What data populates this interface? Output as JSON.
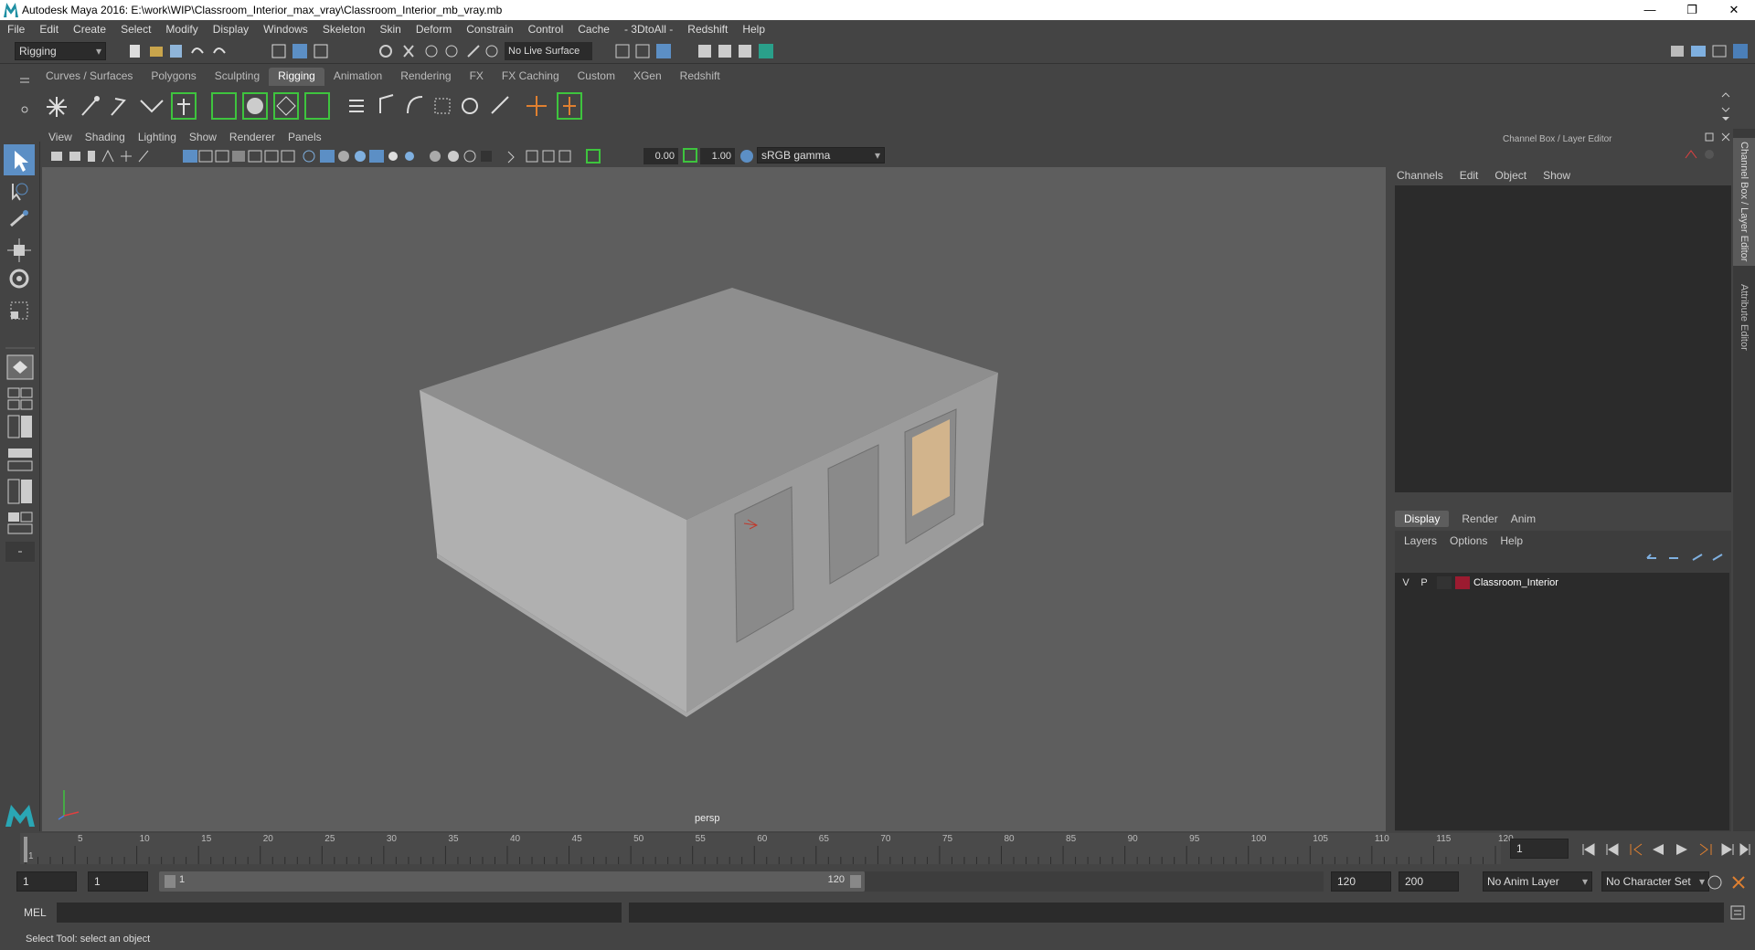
{
  "window": {
    "title": "Autodesk Maya 2016: E:\\work\\WIP\\Classroom_Interior_max_vray\\Classroom_Interior_mb_vray.mb",
    "controls": [
      "—",
      "❐",
      "✕"
    ]
  },
  "menubar": [
    "File",
    "Edit",
    "Create",
    "Select",
    "Modify",
    "Display",
    "Windows",
    "Skeleton",
    "Skin",
    "Deform",
    "Constrain",
    "Control",
    "Cache",
    "- 3DtoAll -",
    "Redshift",
    "Help"
  ],
  "statusline": {
    "menuset": "Rigging",
    "live_surface": "No Live Surface"
  },
  "shelf": {
    "tabs": [
      "Curves / Surfaces",
      "Polygons",
      "Sculpting",
      "Rigging",
      "Animation",
      "Rendering",
      "FX",
      "FX Caching",
      "Custom",
      "XGen",
      "Redshift"
    ],
    "active_tab": "Rigging"
  },
  "viewport": {
    "menus": [
      "View",
      "Shading",
      "Lighting",
      "Show",
      "Renderer",
      "Panels"
    ],
    "exposure": "0.00",
    "gamma": "1.00",
    "colorspace": "sRGB gamma",
    "camera_label": "persp"
  },
  "channel_box": {
    "title": "Channel Box / Layer Editor",
    "menus": [
      "Channels",
      "Edit",
      "Object",
      "Show"
    ],
    "layer_tabs": [
      "Display",
      "Render",
      "Anim"
    ],
    "active_layer_tab": "Display",
    "layer_menus": [
      "Layers",
      "Options",
      "Help"
    ],
    "layers": [
      {
        "v": "V",
        "p": "P",
        "name": "Classroom_Interior",
        "color": "#9b1b30"
      }
    ]
  },
  "side_tabs": [
    "Channel Box / Layer Editor",
    "Attribute Editor"
  ],
  "timeline": {
    "ticks": [
      "1",
      "5",
      "10",
      "15",
      "20",
      "25",
      "30",
      "35",
      "40",
      "45",
      "50",
      "55",
      "60",
      "65",
      "70",
      "75",
      "80",
      "85",
      "90",
      "95",
      "100",
      "105",
      "110",
      "115",
      "120"
    ],
    "current_frame": "1"
  },
  "range": {
    "start": "1",
    "playback_start": "1",
    "slider_start": "1",
    "slider_end": "120",
    "playback_end": "120",
    "end": "200",
    "anim_layer": "No Anim Layer",
    "character_set": "No Character Set"
  },
  "command_line": {
    "language": "MEL"
  },
  "help_line": "Select Tool: select an object"
}
